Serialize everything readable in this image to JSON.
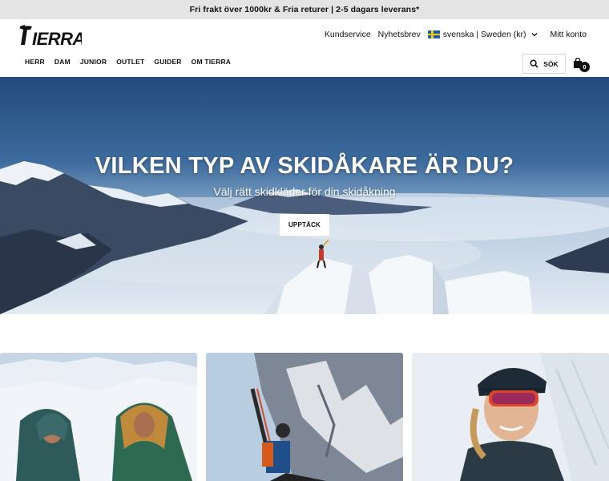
{
  "promo": {
    "text": "Fri frakt över 1000kr & Fria returer | 2-5 dagars leverans*"
  },
  "header": {
    "logo_text": "TIERRA",
    "links": {
      "customer_service": "Kundservice",
      "newsletter": "Nyhetsbrev",
      "account": "Mitt konto"
    },
    "language": {
      "selected": "svenska | Sweden (kr)",
      "flag": "sweden-flag"
    },
    "nav": [
      "HERR",
      "DAM",
      "JUNIOR",
      "OUTLET",
      "GUIDER",
      "OM TIERRA"
    ],
    "search_label": "SÖK",
    "cart_count": "0"
  },
  "hero": {
    "title": "VILKEN TYP AV SKIDÅKARE ÄR DU?",
    "subtitle": "Välj rätt skidkläder för din skidåkning",
    "cta": "UPPTÄCK"
  },
  "colors": {
    "promo_bg": "#e4e4e4",
    "sky": "#2e4f7e",
    "text": "#111111"
  },
  "cards": [
    "card-two-people-puffer-jackets",
    "card-skier-climbing-rock",
    "card-woman-goggles-snow"
  ]
}
